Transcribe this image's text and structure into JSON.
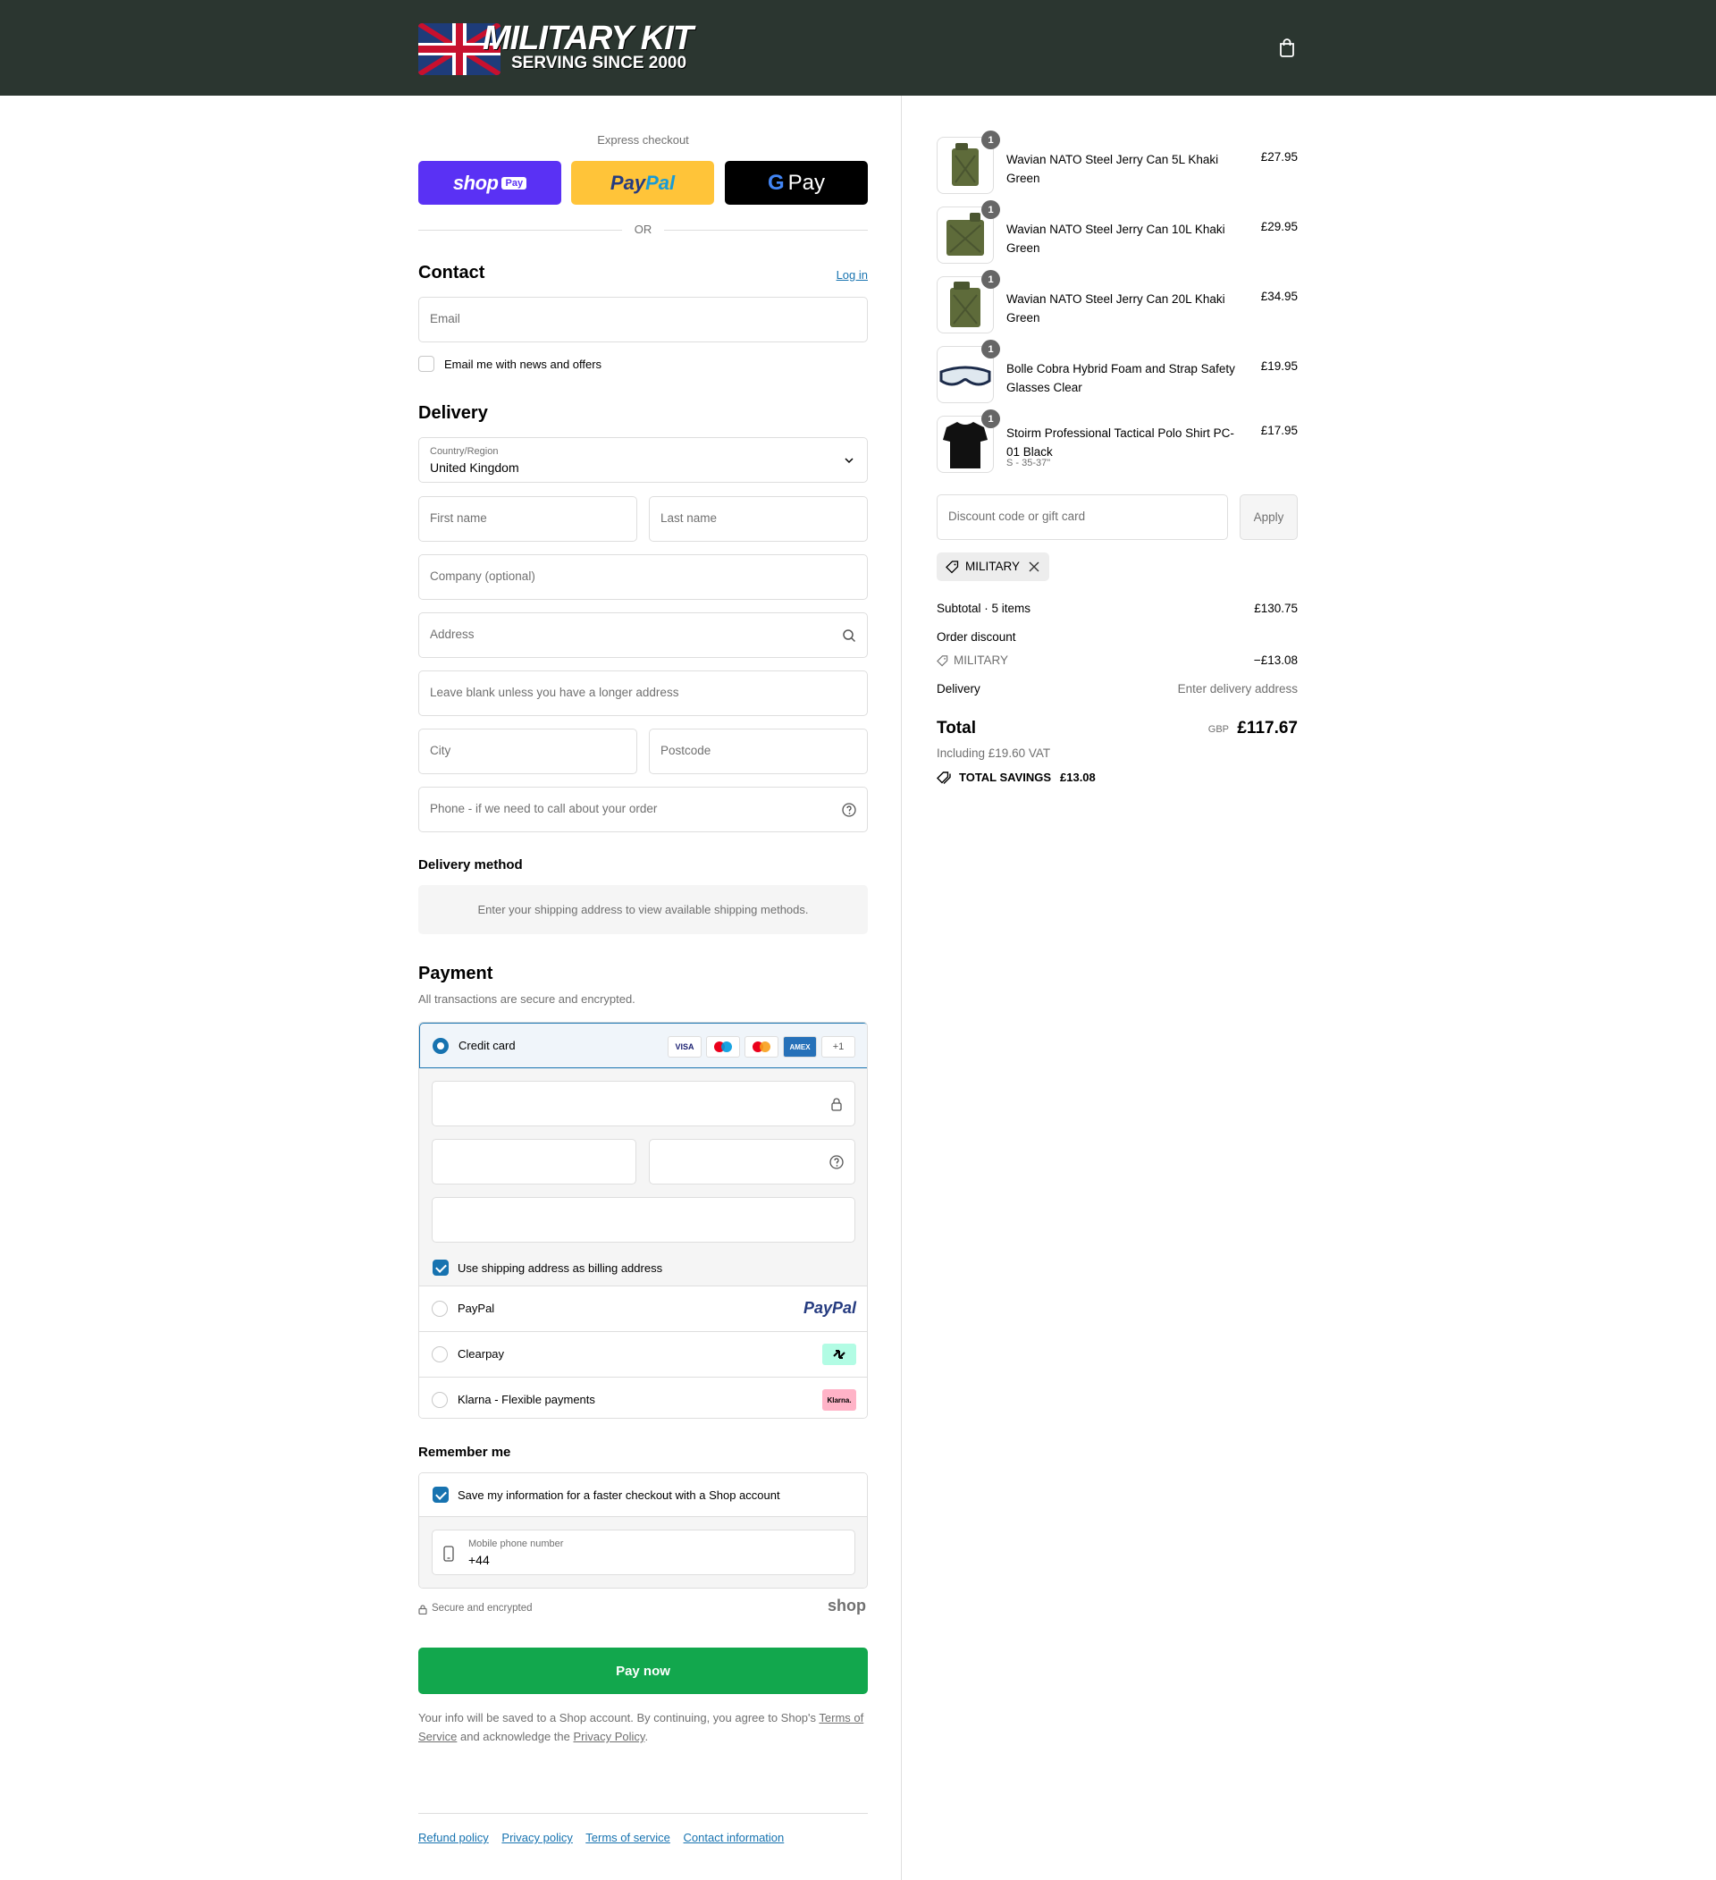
{
  "header": {
    "logo_title": "MILITARY KIT",
    "logo_tagline": "SERVING SINCE 2000",
    "cart_icon": "shopping-bag-icon"
  },
  "express": {
    "title": "Express checkout",
    "shop_label": "shop",
    "shop_pay_badge": "Pay",
    "paypal_label_1": "Pay",
    "paypal_label_2": "Pal",
    "gpay_g": "G",
    "gpay_label": "Pay",
    "or_label": "OR"
  },
  "contact": {
    "heading": "Contact",
    "login_link": "Log in",
    "email_placeholder": "Email",
    "news_checkbox_label": "Email me with news and offers",
    "news_checked": false
  },
  "delivery": {
    "heading": "Delivery",
    "country_label": "Country/Region",
    "country_value": "United Kingdom",
    "first_name_placeholder": "First name",
    "last_name_placeholder": "Last name",
    "company_placeholder": "Company (optional)",
    "address_placeholder": "Address",
    "address2_placeholder": "Leave blank unless you have a longer address",
    "city_placeholder": "City",
    "postcode_placeholder": "Postcode",
    "phone_placeholder": "Phone - if we need to call about your order",
    "method_heading": "Delivery method",
    "method_note": "Enter your shipping address to view available shipping methods."
  },
  "payment": {
    "heading": "Payment",
    "subtitle": "All transactions are secure and encrypted.",
    "credit_card_label": "Credit card",
    "card_logos": [
      "VISA",
      "Maestro",
      "Mastercard",
      "AMEX"
    ],
    "more_cards": "+1",
    "billing_checkbox_label": "Use shipping address as billing address",
    "billing_checked": true,
    "options": [
      {
        "label": "PayPal",
        "logo": "PayPal"
      },
      {
        "label": "Clearpay",
        "logo": "clearpay-icon"
      },
      {
        "label": "Klarna - Flexible payments",
        "logo": "Klarna."
      }
    ]
  },
  "remember": {
    "heading": "Remember me",
    "save_label": "Save my information for a faster checkout with a Shop account",
    "save_checked": true,
    "phone_label": "Mobile phone number",
    "phone_value": "+44",
    "secure_label": "Secure and encrypted",
    "shop_logo": "shop"
  },
  "pay_now_label": "Pay now",
  "fine_print": {
    "text_1": "Your info will be saved to a Shop account. By continuing, you agree to Shop's",
    "terms_link": "Terms of Service",
    "text_2": "and acknowledge the",
    "privacy_link": "Privacy Policy",
    "text_3": "."
  },
  "footer_links": [
    "Refund policy",
    "Privacy policy",
    "Terms of service",
    "Contact information"
  ],
  "order": {
    "items": [
      {
        "name": "Wavian NATO Steel Jerry Can 5L Khaki Green",
        "price": "£27.95",
        "qty": "1",
        "variant": ""
      },
      {
        "name": "Wavian NATO Steel Jerry Can 10L Khaki Green",
        "price": "£29.95",
        "qty": "1",
        "variant": ""
      },
      {
        "name": "Wavian NATO Steel Jerry Can 20L Khaki Green",
        "price": "£34.95",
        "qty": "1",
        "variant": ""
      },
      {
        "name": "Bolle Cobra Hybrid Foam and Strap Safety Glasses Clear",
        "price": "£19.95",
        "qty": "1",
        "variant": ""
      },
      {
        "name": "Stoirm Professional Tactical Polo Shirt PC-01 Black",
        "price": "£17.95",
        "qty": "1",
        "variant": "S - 35-37\""
      }
    ],
    "discount_placeholder": "Discount code or gift card",
    "apply_label": "Apply",
    "applied_code": "MILITARY",
    "subtotal_label": "Subtotal · 5 items",
    "subtotal_value": "£130.75",
    "order_discount_label": "Order discount",
    "discount_code": "MILITARY",
    "discount_value": "−£13.08",
    "delivery_label": "Delivery",
    "delivery_value": "Enter delivery address",
    "total_label": "Total",
    "currency": "GBP",
    "total_value": "£117.67",
    "vat_note": "Including £19.60 VAT",
    "savings_label": "TOTAL SAVINGS",
    "savings_value": "£13.08"
  },
  "colors": {
    "header_bg": "#2b3630",
    "accent": "#1773b0",
    "pay_button": "#12a74d",
    "shop_pay": "#5a31f4",
    "paypal": "#ffc439"
  }
}
